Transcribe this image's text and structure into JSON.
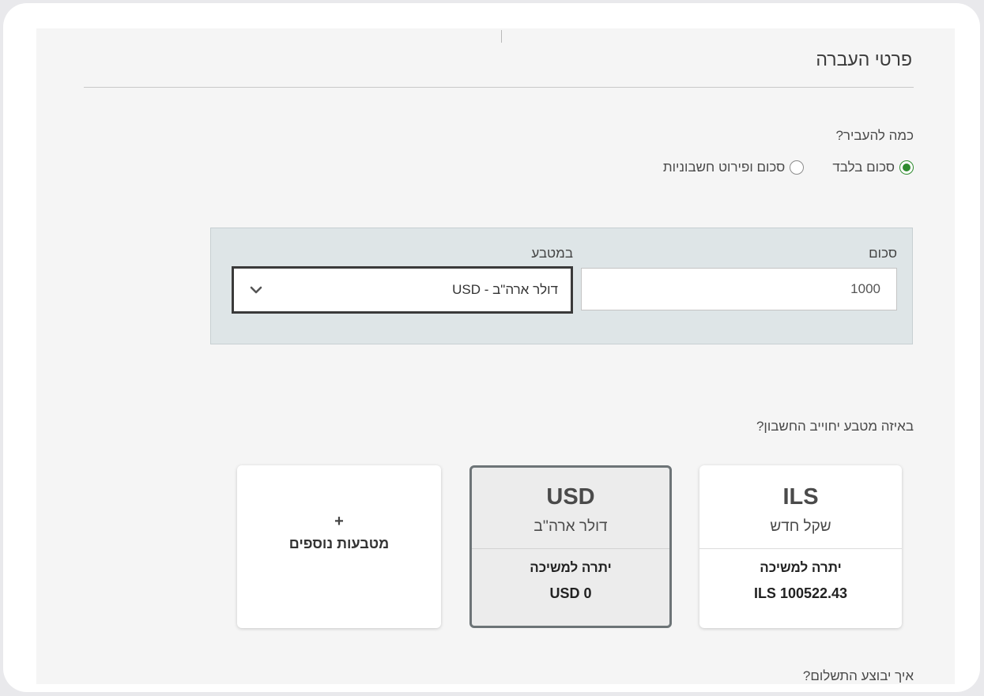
{
  "transfer": {
    "section_title": "פרטי העברה",
    "amount_question": "כמה להעביר?",
    "options": [
      {
        "label": "סכום בלבד",
        "checked": true
      },
      {
        "label": "סכום ופירוט חשבוניות",
        "checked": false
      }
    ]
  },
  "amount_panel": {
    "amount_label": "סכום",
    "amount_value": "1000",
    "currency_label": "במטבע",
    "currency_selected": "דולר ארה\"ב - USD",
    "dropdown_icon": "chevron-down-icon"
  },
  "charge": {
    "question": "באיזה מטבע יחוייב החשבון?",
    "cards": [
      {
        "code": "ILS",
        "name": "שקל חדש",
        "balance_label": "יתרה למשיכה",
        "balance_value": "100522.43 ILS",
        "selected": false
      },
      {
        "code": "USD",
        "name": "דולר ארה''ב",
        "balance_label": "יתרה למשיכה",
        "balance_value": "0 USD",
        "selected": true
      }
    ],
    "more": {
      "plus": "+",
      "label": "מטבעות נוספים"
    }
  },
  "cut_off_text": "איך יבוצע התשלום?",
  "colors": {
    "radio_checked": "#2e8b2e",
    "panel_bg": "#dee5e7",
    "selected_card_border": "#6d7477"
  }
}
